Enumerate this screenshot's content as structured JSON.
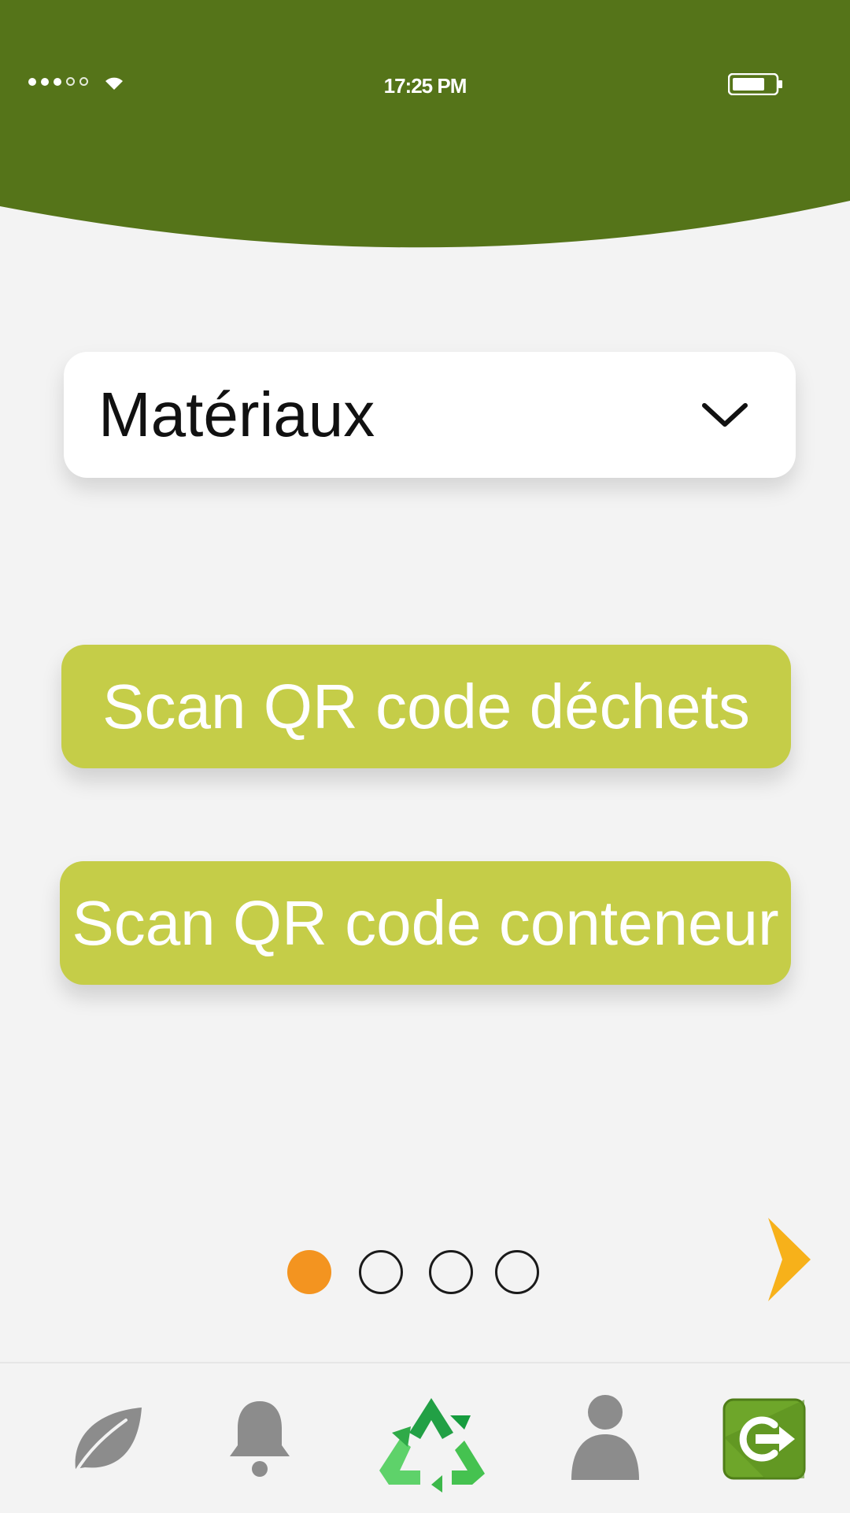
{
  "status_bar": {
    "time": "17:25 PM",
    "signal_dots": [
      "full",
      "full",
      "full",
      "empty",
      "empty"
    ],
    "battery_level": 0.8
  },
  "colors": {
    "header_green": "#557419",
    "button_lime": "#c5cd48",
    "accent_orange": "#f39420",
    "arrow_yellow": "#f7b11a",
    "icon_gray": "#8c8c8c"
  },
  "material_select": {
    "value": "Matériaux"
  },
  "buttons": {
    "scan_waste": "Scan QR code déchets",
    "scan_container": "Scan QR code conteneur"
  },
  "pager": {
    "pages": 4,
    "active_index": 0
  },
  "tabbar": {
    "items": [
      {
        "icon": "leaf-icon"
      },
      {
        "icon": "bell-icon"
      },
      {
        "icon": "recycle-icon",
        "active": true
      },
      {
        "icon": "user-icon"
      },
      {
        "icon": "logout-icon"
      }
    ]
  }
}
